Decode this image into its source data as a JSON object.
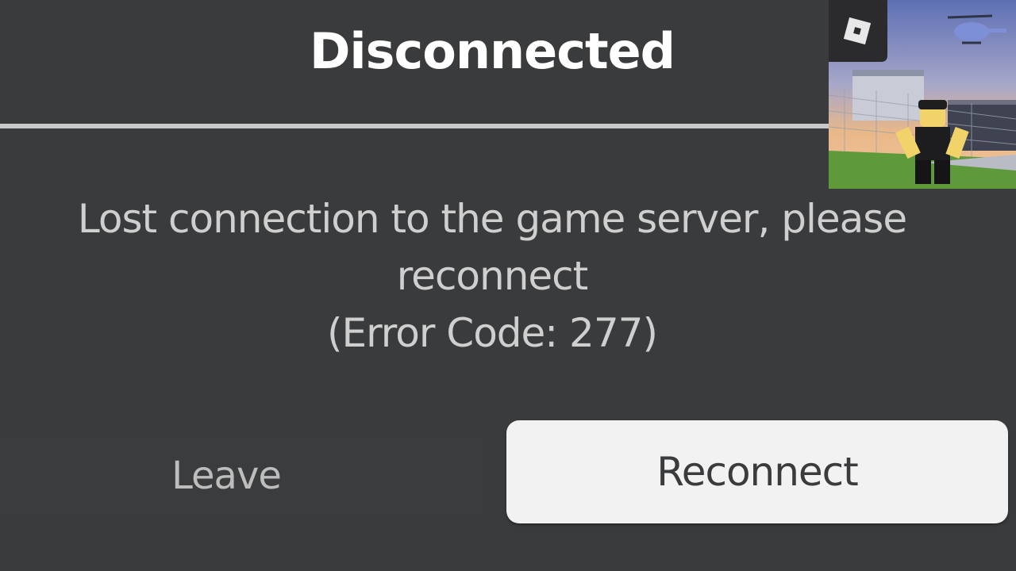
{
  "dialog": {
    "title": "Disconnected",
    "message_line1": "Lost connection to the game server, please",
    "message_line2": "reconnect",
    "error_code": "(Error Code: 277)"
  },
  "buttons": {
    "leave_label": "Leave",
    "reconnect_label": "Reconnect"
  },
  "thumbnail": {
    "logo_icon": "roblox-logo-icon",
    "scene": "game-scene-thumbnail"
  },
  "colors": {
    "background": "#393b3d",
    "title_text": "#ffffff",
    "message_text": "#cfcfcf",
    "reconnect_bg": "#f2f2f2"
  }
}
